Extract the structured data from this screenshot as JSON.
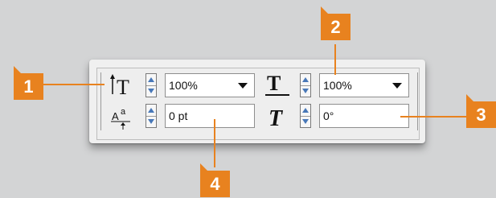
{
  "character_panel": {
    "vertical_scale": {
      "value": "100%"
    },
    "horizontal_scale": {
      "value": "100%"
    },
    "baseline_shift": {
      "value": "0 pt"
    },
    "skew": {
      "value": "0°"
    }
  },
  "callouts": [
    {
      "label": "1"
    },
    {
      "label": "2"
    },
    {
      "label": "3"
    },
    {
      "label": "4"
    }
  ],
  "colors": {
    "callout": "#e8821f",
    "background": "#d3d4d5",
    "panel": "#f0f0f0",
    "spinner_arrow": "#4878b8"
  },
  "icons": {
    "vertical_scale": "vertical-scale-icon",
    "horizontal_scale": "horizontal-scale-icon",
    "baseline_shift": "baseline-shift-icon",
    "skew": "skew-icon"
  }
}
